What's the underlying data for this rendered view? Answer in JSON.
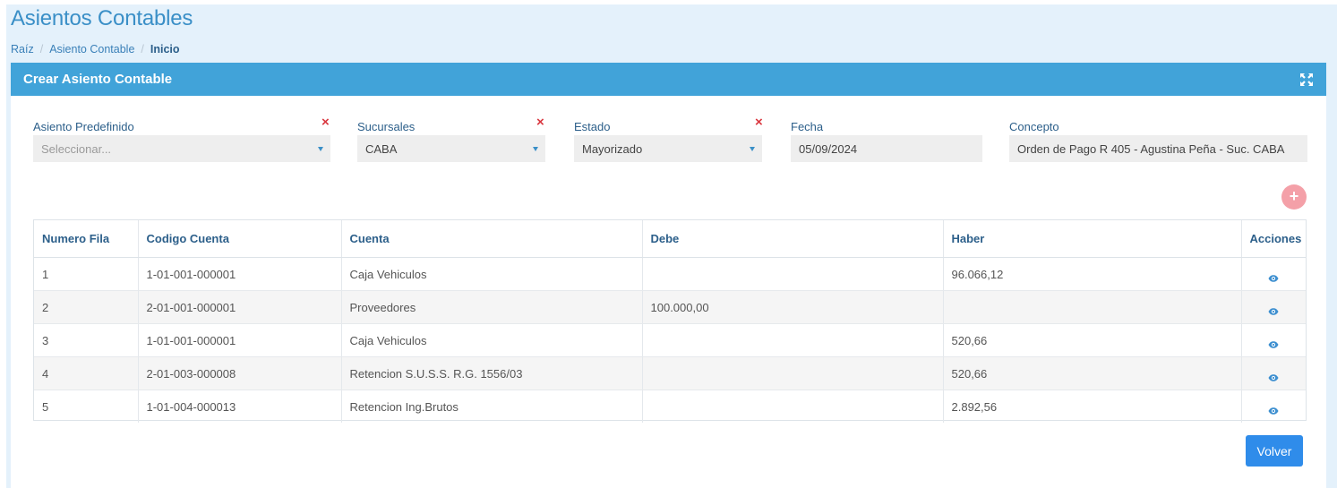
{
  "page": {
    "title": "Asientos Contables"
  },
  "breadcrumb": {
    "root": "Raíz",
    "middle": "Asiento Contable",
    "current": "Inicio",
    "separator": "/"
  },
  "panel": {
    "title": "Crear Asiento Contable",
    "expand_icon": "expand-arrows-icon"
  },
  "form": {
    "asiento_predefinido": {
      "label": "Asiento Predefinido",
      "placeholder": "Seleccionar...",
      "value": "",
      "clear": "×"
    },
    "sucursales": {
      "label": "Sucursales",
      "value": "CABA",
      "clear": "×"
    },
    "estado": {
      "label": "Estado",
      "value": "Mayorizado",
      "clear": "×"
    },
    "fecha": {
      "label": "Fecha",
      "value": "05/09/2024"
    },
    "concepto": {
      "label": "Concepto",
      "value": "Orden de Pago R 405 - Agustina Peña - Suc. CABA"
    }
  },
  "add_row_label": "+",
  "table": {
    "headers": {
      "numero_fila": "Numero Fila",
      "codigo_cuenta": "Codigo Cuenta",
      "cuenta": "Cuenta",
      "debe": "Debe",
      "haber": "Haber",
      "acciones": "Acciones"
    },
    "rows": [
      {
        "numero": "1",
        "codigo": "1-01-001-000001",
        "cuenta": "Caja Vehiculos",
        "debe": "",
        "haber": "96.066,12",
        "action_icon": "eye-icon"
      },
      {
        "numero": "2",
        "codigo": "2-01-001-000001",
        "cuenta": "Proveedores",
        "debe": "100.000,00",
        "haber": "",
        "action_icon": "eye-icon"
      },
      {
        "numero": "3",
        "codigo": "1-01-001-000001",
        "cuenta": "Caja Vehiculos",
        "debe": "",
        "haber": "520,66",
        "action_icon": "eye-icon"
      },
      {
        "numero": "4",
        "codigo": "2-01-003-000008",
        "cuenta": "Retencion S.U.S.S. R.G. 1556/03",
        "debe": "",
        "haber": "520,66",
        "action_icon": "eye-icon"
      },
      {
        "numero": "5",
        "codigo": "1-01-004-000013",
        "cuenta": "Retencion Ing.Brutos",
        "debe": "",
        "haber": "2.892,56",
        "action_icon": "eye-icon"
      }
    ]
  },
  "buttons": {
    "volver": "Volver"
  },
  "colors": {
    "header_blue": "#41a3d9",
    "link_blue": "#3a8fc7",
    "button_blue": "#2f8cea",
    "clear_red": "#d9363e",
    "add_pink": "#f4a0a8"
  }
}
